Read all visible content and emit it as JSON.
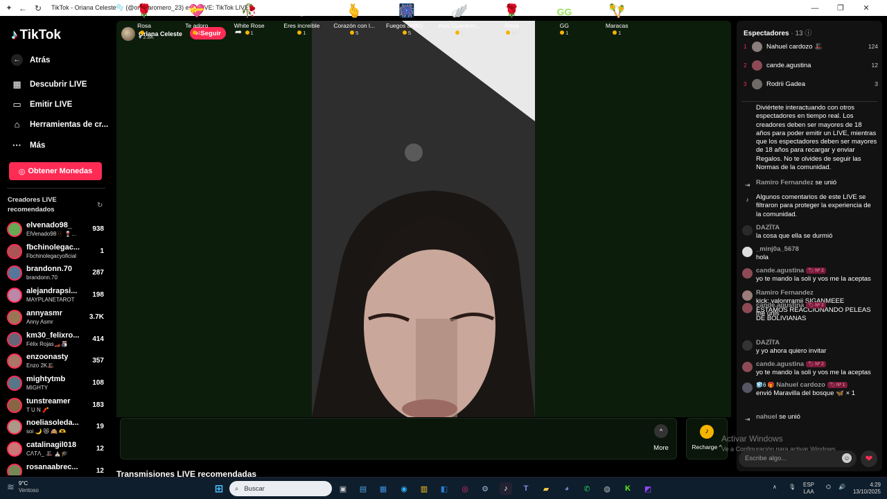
{
  "browser": {
    "title": "TikTok - Oriana Celeste🫧 (@orianaromero_23) está LIVE: TikTok LIVE",
    "back": "←",
    "reload": "↻",
    "minimize": "—",
    "restore": "❐",
    "close": "✕"
  },
  "sidebar": {
    "logo": "TikTok",
    "back_label": "Atrás",
    "nav": [
      {
        "label": "Descubrir LIVE",
        "icon": "calendar-live-icon"
      },
      {
        "label": "Emitir LIVE",
        "icon": "video-camera-icon"
      },
      {
        "label": "Herramientas de cr...",
        "icon": "home-tools-icon"
      },
      {
        "label": "Más",
        "icon": "ellipsis-icon"
      }
    ],
    "coins_button": "Obtener Monedas",
    "recommended_title": "Creadores LIVE recomendados",
    "creators": [
      {
        "name": "elvenado98_",
        "sub": "ElVenado98🫥 🍷...",
        "count": "938"
      },
      {
        "name": "fbchinolegac...",
        "sub": "Fbchinolegacyoficial",
        "count": "1"
      },
      {
        "name": "brandonn.70",
        "sub": "brandonn.70",
        "count": "287"
      },
      {
        "name": "alejandrapsi...",
        "sub": "MAYPLANETAROT",
        "count": "198"
      },
      {
        "name": "annyasmr",
        "sub": "Anny Asmr",
        "count": "3.7K"
      },
      {
        "name": "km30_felixro...",
        "sub": "Félix Rojas🏎️🎳",
        "count": "414"
      },
      {
        "name": "enzoonasty",
        "sub": "Enzo 2K🎩",
        "count": "357"
      },
      {
        "name": "mightytmb",
        "sub": "MIGHTY",
        "count": "108"
      },
      {
        "name": "tunstreamer",
        "sub": "T U N 🧨",
        "count": "183"
      },
      {
        "name": "noeliasoleda...",
        "sub": "soi 🌙 😻 🙈 🫶",
        "count": "19"
      },
      {
        "name": "catalinagil018",
        "sub": "CΛTΛ_ 🎩 ⛪🎓",
        "count": "12"
      },
      {
        "name": "rosanaabrec...",
        "sub": "",
        "count": "12"
      }
    ]
  },
  "stream": {
    "name": "Oriana Celeste",
    "likes": "2.8K",
    "follow_label": "+ Seguir",
    "share_icon": "share-arrow-icon"
  },
  "gifts": [
    {
      "name": "Rosa",
      "price": "1",
      "icon": "🌹"
    },
    {
      "name": "Te adoro",
      "price": "1",
      "icon": "💝"
    },
    {
      "name": "White Rose",
      "price": "1",
      "icon": "🥀"
    },
    {
      "name": "Eres increíble",
      "price": "1",
      "icon": "🐱"
    },
    {
      "name": "Corazón con l...",
      "price": "5",
      "icon": "🫰"
    },
    {
      "name": "Fuegos artifici...",
      "price": "5",
      "icon": "🎆"
    },
    {
      "name": "Alas Guardian...",
      "price": "1",
      "icon": "🪽"
    },
    {
      "name": "Rosa",
      "price": "10",
      "icon": "🌹"
    },
    {
      "name": "GG",
      "price": "1",
      "icon": "GG"
    },
    {
      "name": "Maracas",
      "price": "1",
      "icon": "🪇"
    }
  ],
  "more_label": "More",
  "more_icon": "^",
  "recharge_label": "Recharge ^",
  "recommended_streams_title": "Transmisiones LIVE recomendadas",
  "chat": {
    "viewers_label": "Espectadores",
    "viewers_count": "· 13",
    "top_viewers": [
      {
        "rank": "1",
        "name": "Nahuel cardozo 🎩",
        "score": "124"
      },
      {
        "rank": "2",
        "name": "cande.agustina",
        "score": "12"
      },
      {
        "rank": "3",
        "name": "Rodrii Gadea",
        "score": "3"
      }
    ],
    "messages": [
      {
        "user": "",
        "text": "Diviértete interactuando con otros espectadores en tiempo real. Los creadores deben ser mayores de 18 años para poder emitir un LIVE, mientras que los espectadores deben ser mayores de 18 años para recargar y enviar Regalos. No te olvides de seguir las Normas de la comunidad."
      },
      {
        "user": "Ramiro Fernandez",
        "text": "se unió"
      },
      {
        "user": "",
        "text": "Algunos comentarios de este LIVE se filtraron para proteger la experiencia de la comunidad."
      },
      {
        "user": "DAZÏTA",
        "text": "la cosa que ella se durmió"
      },
      {
        "user": "_minj0a_5678",
        "text": "hola"
      },
      {
        "user": "cande.agustina",
        "badge": "🏷 Nº 2",
        "text": "yo te mando la soli y vos me la aceptas"
      },
      {
        "user": "Ramiro Fernandez",
        "text": "kick: valonrramii SIGANMEEE ESTAMOS REACCIONANDO PELEAS DE BOLIVIANAS"
      },
      {
        "user": "cande.agustina",
        "badge": "🏷 Nº 2",
        "text": "me unis"
      },
      {
        "user": "DAZÏTA",
        "text": "y yo ahora quiero invitar"
      },
      {
        "user": "cande.agustina",
        "badge": "🏷 Nº 2",
        "text": "yo te mando la soli y vos me la aceptas"
      },
      {
        "user": "Nahuel cardozo",
        "badge": "🏷 Nº 1",
        "prefix": "🧊6 🎁",
        "text": "envió Maravilla del bosque 🦋 × 1"
      },
      {
        "user": "nahuel",
        "text": "se unió"
      }
    ],
    "input_placeholder": "Escribe algo...",
    "emoji_icon": "☺",
    "heart_icon": "❤"
  },
  "watermark": {
    "title": "Activar Windows",
    "sub": "Ve a Configuración para activar Windows."
  },
  "taskbar": {
    "weather_temp": "9°C",
    "weather_desc": "Ventoso",
    "search_placeholder": "Buscar",
    "lang": "ESP",
    "lang2": "LAA",
    "time": "4:29",
    "date": "13/10/2025"
  },
  "colors": {
    "brand": "#fe2c55",
    "stage_bg": "#0d1d0c",
    "chat_bg": "#121212"
  }
}
